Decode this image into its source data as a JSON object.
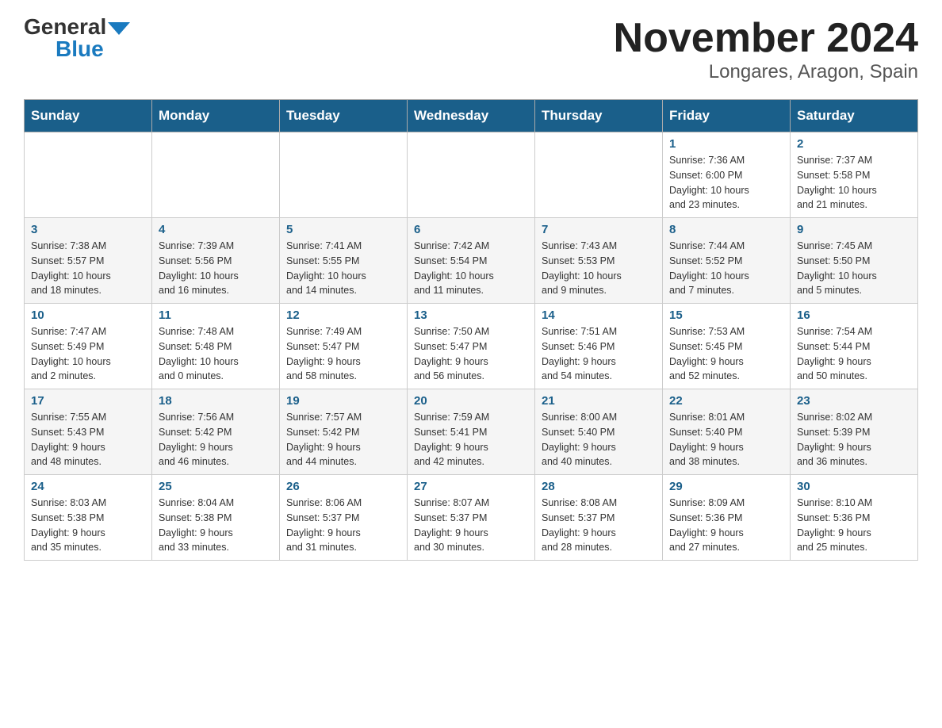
{
  "logo": {
    "general": "General",
    "blue": "Blue"
  },
  "title": "November 2024",
  "subtitle": "Longares, Aragon, Spain",
  "weekdays": [
    "Sunday",
    "Monday",
    "Tuesday",
    "Wednesday",
    "Thursday",
    "Friday",
    "Saturday"
  ],
  "weeks": [
    [
      {
        "day": "",
        "info": ""
      },
      {
        "day": "",
        "info": ""
      },
      {
        "day": "",
        "info": ""
      },
      {
        "day": "",
        "info": ""
      },
      {
        "day": "",
        "info": ""
      },
      {
        "day": "1",
        "info": "Sunrise: 7:36 AM\nSunset: 6:00 PM\nDaylight: 10 hours\nand 23 minutes."
      },
      {
        "day": "2",
        "info": "Sunrise: 7:37 AM\nSunset: 5:58 PM\nDaylight: 10 hours\nand 21 minutes."
      }
    ],
    [
      {
        "day": "3",
        "info": "Sunrise: 7:38 AM\nSunset: 5:57 PM\nDaylight: 10 hours\nand 18 minutes."
      },
      {
        "day": "4",
        "info": "Sunrise: 7:39 AM\nSunset: 5:56 PM\nDaylight: 10 hours\nand 16 minutes."
      },
      {
        "day": "5",
        "info": "Sunrise: 7:41 AM\nSunset: 5:55 PM\nDaylight: 10 hours\nand 14 minutes."
      },
      {
        "day": "6",
        "info": "Sunrise: 7:42 AM\nSunset: 5:54 PM\nDaylight: 10 hours\nand 11 minutes."
      },
      {
        "day": "7",
        "info": "Sunrise: 7:43 AM\nSunset: 5:53 PM\nDaylight: 10 hours\nand 9 minutes."
      },
      {
        "day": "8",
        "info": "Sunrise: 7:44 AM\nSunset: 5:52 PM\nDaylight: 10 hours\nand 7 minutes."
      },
      {
        "day": "9",
        "info": "Sunrise: 7:45 AM\nSunset: 5:50 PM\nDaylight: 10 hours\nand 5 minutes."
      }
    ],
    [
      {
        "day": "10",
        "info": "Sunrise: 7:47 AM\nSunset: 5:49 PM\nDaylight: 10 hours\nand 2 minutes."
      },
      {
        "day": "11",
        "info": "Sunrise: 7:48 AM\nSunset: 5:48 PM\nDaylight: 10 hours\nand 0 minutes."
      },
      {
        "day": "12",
        "info": "Sunrise: 7:49 AM\nSunset: 5:47 PM\nDaylight: 9 hours\nand 58 minutes."
      },
      {
        "day": "13",
        "info": "Sunrise: 7:50 AM\nSunset: 5:47 PM\nDaylight: 9 hours\nand 56 minutes."
      },
      {
        "day": "14",
        "info": "Sunrise: 7:51 AM\nSunset: 5:46 PM\nDaylight: 9 hours\nand 54 minutes."
      },
      {
        "day": "15",
        "info": "Sunrise: 7:53 AM\nSunset: 5:45 PM\nDaylight: 9 hours\nand 52 minutes."
      },
      {
        "day": "16",
        "info": "Sunrise: 7:54 AM\nSunset: 5:44 PM\nDaylight: 9 hours\nand 50 minutes."
      }
    ],
    [
      {
        "day": "17",
        "info": "Sunrise: 7:55 AM\nSunset: 5:43 PM\nDaylight: 9 hours\nand 48 minutes."
      },
      {
        "day": "18",
        "info": "Sunrise: 7:56 AM\nSunset: 5:42 PM\nDaylight: 9 hours\nand 46 minutes."
      },
      {
        "day": "19",
        "info": "Sunrise: 7:57 AM\nSunset: 5:42 PM\nDaylight: 9 hours\nand 44 minutes."
      },
      {
        "day": "20",
        "info": "Sunrise: 7:59 AM\nSunset: 5:41 PM\nDaylight: 9 hours\nand 42 minutes."
      },
      {
        "day": "21",
        "info": "Sunrise: 8:00 AM\nSunset: 5:40 PM\nDaylight: 9 hours\nand 40 minutes."
      },
      {
        "day": "22",
        "info": "Sunrise: 8:01 AM\nSunset: 5:40 PM\nDaylight: 9 hours\nand 38 minutes."
      },
      {
        "day": "23",
        "info": "Sunrise: 8:02 AM\nSunset: 5:39 PM\nDaylight: 9 hours\nand 36 minutes."
      }
    ],
    [
      {
        "day": "24",
        "info": "Sunrise: 8:03 AM\nSunset: 5:38 PM\nDaylight: 9 hours\nand 35 minutes."
      },
      {
        "day": "25",
        "info": "Sunrise: 8:04 AM\nSunset: 5:38 PM\nDaylight: 9 hours\nand 33 minutes."
      },
      {
        "day": "26",
        "info": "Sunrise: 8:06 AM\nSunset: 5:37 PM\nDaylight: 9 hours\nand 31 minutes."
      },
      {
        "day": "27",
        "info": "Sunrise: 8:07 AM\nSunset: 5:37 PM\nDaylight: 9 hours\nand 30 minutes."
      },
      {
        "day": "28",
        "info": "Sunrise: 8:08 AM\nSunset: 5:37 PM\nDaylight: 9 hours\nand 28 minutes."
      },
      {
        "day": "29",
        "info": "Sunrise: 8:09 AM\nSunset: 5:36 PM\nDaylight: 9 hours\nand 27 minutes."
      },
      {
        "day": "30",
        "info": "Sunrise: 8:10 AM\nSunset: 5:36 PM\nDaylight: 9 hours\nand 25 minutes."
      }
    ]
  ]
}
